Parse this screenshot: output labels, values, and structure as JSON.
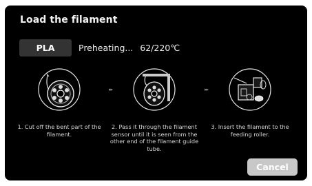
{
  "dialog": {
    "title": "Load the filament",
    "material_label": "PLA",
    "status_text": "Preheating...",
    "temperature_text": "62/220℃"
  },
  "steps": [
    {
      "illustration": "spool-cut-icon",
      "caption": "1. Cut off the bent part  of the filament."
    },
    {
      "illustration": "filament-sensor-icon",
      "caption": "2. Pass it through the filament sensor until it is seen from the other end of the filament guide tube."
    },
    {
      "illustration": "feeding-roller-icon",
      "caption": "3. Insert the filament to the feeding roller."
    }
  ],
  "arrows": [
    "▸▸",
    "▸▸"
  ],
  "actions": {
    "cancel_label": "Cancel"
  },
  "colors": {
    "background": "#000000",
    "material_button": "#333333",
    "cancel_button": "#c8c8c8",
    "text": "#ffffff"
  }
}
